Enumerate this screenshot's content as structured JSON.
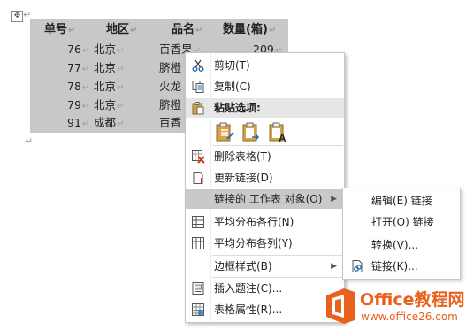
{
  "table": {
    "headers": [
      "单号",
      "地区",
      "品名",
      "数量(箱)"
    ],
    "rows": [
      {
        "id": "76",
        "region": "北京",
        "product": "百香果",
        "qty": "209"
      },
      {
        "id": "77",
        "region": "北京",
        "product": "脐橙"
      },
      {
        "id": "78",
        "region": "北京",
        "product": "火龙"
      },
      {
        "id": "79",
        "region": "北京",
        "product": "脐橙"
      },
      {
        "id": "91",
        "region": "成都",
        "product": "百香"
      }
    ]
  },
  "menu": {
    "cut": "剪切(T)",
    "copy": "复制(C)",
    "paste_options": "粘贴选项:",
    "delete_table": "删除表格(T)",
    "update_link": "更新链接(D)",
    "linked_object": "链接的 工作表 对象(O)",
    "distribute_rows": "平均分布各行(N)",
    "distribute_cols": "平均分布各列(Y)",
    "border_style": "边框样式(B)",
    "insert_caption": "插入题注(C)...",
    "table_props": "表格属性(R)..."
  },
  "submenu": {
    "edit_link": "编辑(E) 链接",
    "open_link": "打开(O) 链接",
    "convert": "转换(V)...",
    "links": "链接(K)..."
  },
  "watermark": {
    "title": "Office教程网",
    "url": "www.office26.com"
  },
  "colors": {
    "accent": "#e8611d",
    "selection": "#c8c8c8",
    "highlight": "#c9c9c9"
  }
}
